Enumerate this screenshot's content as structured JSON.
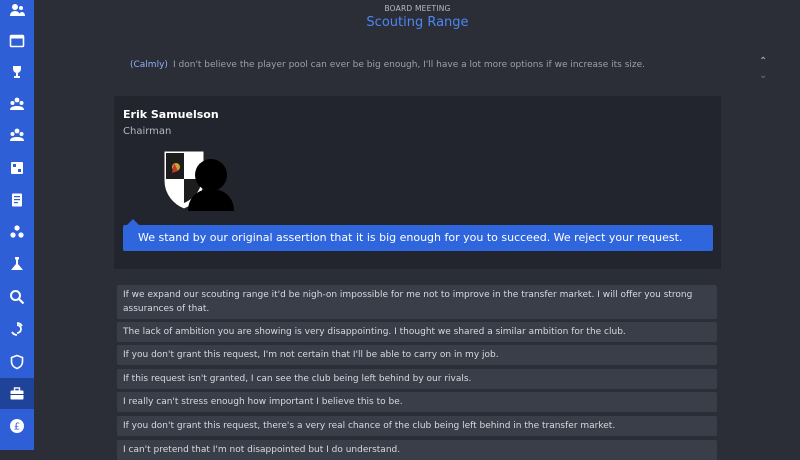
{
  "sidebar": {
    "items": [
      {
        "icon": "people-icon"
      },
      {
        "icon": "window-icon"
      },
      {
        "icon": "trophy-icon"
      },
      {
        "icon": "group-icon"
      },
      {
        "icon": "team-icon"
      },
      {
        "icon": "notes-icon"
      },
      {
        "icon": "document-icon"
      },
      {
        "icon": "network-icon"
      },
      {
        "icon": "flask-icon"
      },
      {
        "icon": "search-icon"
      },
      {
        "icon": "transfer-icon"
      },
      {
        "icon": "shield-icon"
      },
      {
        "icon": "briefcase-icon",
        "active": true
      },
      {
        "icon": "pound-icon"
      }
    ]
  },
  "header": {
    "subtitle": "BOARD MEETING",
    "title": "Scouting Range"
  },
  "quote": {
    "tone": "(Calmly)",
    "text": "I don't believe the player pool can ever be big enough, I'll have a lot more options if we increase its size."
  },
  "chairman": {
    "name": "Erik Samuelson",
    "role": "Chairman",
    "response": "We stand by our original assertion that it is big enough for you to succeed. We reject your request."
  },
  "options": [
    "If we expand our scouting range it'd be nigh-on impossible for me not to improve in the transfer market. I will offer you strong assurances of that.",
    "The lack of ambition you are showing is very disappointing. I thought we shared a similar ambition for the club.",
    "If you don't grant this request, I'm not certain that I'll be able to carry on in my job.",
    "If this request isn't granted, I can see the club being left behind by our rivals.",
    "I really can't stress enough how important I believe this to be.",
    "If you don't grant this request, there's a very real chance of the club being left behind in the transfer market.",
    "I can't pretend that I'm not disappointed but I do understand."
  ],
  "colors": {
    "sidebar": "#2f5fd6",
    "accent": "#4d86f2",
    "bubble": "#2f66dd",
    "background": "#2b2e37"
  }
}
